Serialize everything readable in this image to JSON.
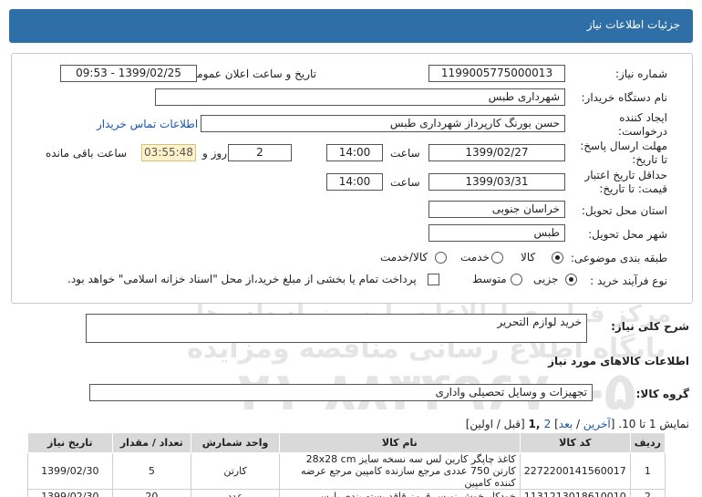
{
  "header": {
    "title": "جزئیات اطلاعات نیاز"
  },
  "watermark": {
    "digits": "61881881",
    "org": "مرکز فراوری اطلاعات پارس نماد داده ها",
    "portal": "پایگاه اطلاع رسانی مناقصه ومزایده",
    "phone": "۰۲۱-۸۸۳۴۹۶۷۰-۵"
  },
  "form": {
    "need_number_label": "شماره نیاز:",
    "need_number": "1199005775000013",
    "announce_label": "تاریخ و ساعت اعلان عمومی:",
    "announce_value": "1399/02/25 - 09:53",
    "buyer_label": "نام دستگاه خریدار:",
    "buyer_value": "شهرداری طبس",
    "creator_label_1": "ایجاد کننده",
    "creator_label_2": "درخواست:",
    "creator_value": "حسن بورنگ کارپرداز شهرداری طبس",
    "contact_link": "اطلاعات تماس خریدار",
    "deadline_label_1": "مهلت ارسال پاسخ:",
    "deadline_label_2": "تا تاریخ:",
    "deadline_date": "1399/02/27",
    "time_label": "ساعت",
    "deadline_time": "14:00",
    "days_value": "2",
    "days_label": "روز و",
    "remaining_time": "03:55:48",
    "remaining_label": "ساعت باقی مانده",
    "validity_label_1": "حداقل تاریخ اعتبار",
    "validity_label_2": "قیمت: تا تاریخ:",
    "validity_date": "1399/03/31",
    "validity_time": "14:00",
    "province_label": "استان محل تحویل:",
    "province_value": "خراسان جنوبی",
    "city_label": "شهر محل تحویل:",
    "city_value": "طبس",
    "category_label": "طبقه بندی موضوعی:",
    "category_options": [
      "کالا",
      "خدمت",
      "کالا/خدمت"
    ],
    "category_selected": 0,
    "process_label": "نوع فرآیند خرید :",
    "process_options": [
      "جزیی",
      "متوسط"
    ],
    "process_selected": 0,
    "process_note": "پرداخت تمام یا بخشی از مبلغ خرید،از محل \"اسناد خزانه اسلامی\" خواهد بود."
  },
  "summary": {
    "label": "شرح کلی نیاز:",
    "value": "خرید لوازم التحریر"
  },
  "goods_info_title": "اطلاعات کالاهای مورد نیاز",
  "goods_group": {
    "label": "گروه کالا:",
    "value": "تجهیزات و وسایل تحصیلی واداری"
  },
  "pagination": {
    "prefix": "نمایش 1 تا 10. [",
    "last": "آخرین",
    "sep1": " / ",
    "next": "بعد",
    "sep2": "] ",
    "page2": "2",
    "page1": " ,1",
    "suffix": " [قبل / اولین]"
  },
  "table": {
    "headers": [
      "ردیف",
      "کد کالا",
      "نام کالا",
      "واحد شمارش",
      "تعداد / مقدار",
      "تاریخ نیاز"
    ],
    "rows": [
      {
        "row": "1",
        "code": "2272200141560017",
        "name": "کاغذ چاپگر کارین لس سه نسخه سایز 28x28 cm کارتن 750 عددی مرجع سازنده کامپین مرجع عرضه کننده کامپین",
        "unit": "کارتن",
        "qty": "5",
        "date": "1399/02/30"
      },
      {
        "row": "2",
        "code": "1131213018610010",
        "name": "خودکار خوش نویس قرمز قاقد بسته بندی پارس",
        "unit": "عدد",
        "qty": "20",
        "date": "1399/02/30"
      }
    ]
  }
}
